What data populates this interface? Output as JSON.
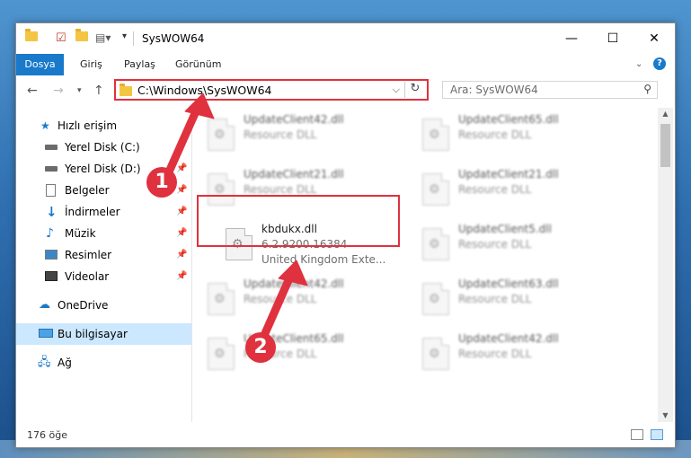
{
  "window": {
    "title": "SysWOW64"
  },
  "ribbon": {
    "tabs": [
      "Dosya",
      "Giriş",
      "Paylaş",
      "Görünüm"
    ]
  },
  "address": {
    "path": "C:\\Windows\\SysWOW64"
  },
  "search": {
    "placeholder": "Ara: SysWOW64"
  },
  "nav": {
    "items": [
      {
        "label": "Hızlı erişim",
        "icon": "star-icon"
      },
      {
        "label": "Yerel Disk (C:)",
        "icon": "drive-icon"
      },
      {
        "label": "Yerel Disk (D:)",
        "icon": "drive-icon"
      },
      {
        "label": "Belgeler",
        "icon": "documents-icon"
      },
      {
        "label": "İndirmeler",
        "icon": "download-icon"
      },
      {
        "label": "Müzik",
        "icon": "music-icon"
      },
      {
        "label": "Resimler",
        "icon": "pictures-icon"
      },
      {
        "label": "Videolar",
        "icon": "videos-icon"
      },
      {
        "label": "OneDrive",
        "icon": "cloud-icon"
      },
      {
        "label": "Bu bilgisayar",
        "icon": "computer-icon"
      },
      {
        "label": "Ağ",
        "icon": "network-icon"
      }
    ]
  },
  "files": [
    {
      "name": "UpdateClient42.dll",
      "desc": "Resource DLL"
    },
    {
      "name": "UpdateClient65.dll",
      "desc": "Resource DLL"
    },
    {
      "name": "UpdateClient21.dll",
      "desc": "Resource DLL"
    },
    {
      "name": "UpdateClient21.dll",
      "desc": "Resource DLL"
    },
    {
      "name": "kbdukx.dll",
      "version": "6.2.9200.16384",
      "desc": "United Kingdom Exte..."
    },
    {
      "name": "UpdateClient5.dll",
      "desc": "Resource DLL"
    },
    {
      "name": "UpdateClient42.dll",
      "desc": "Resource DLL"
    },
    {
      "name": "UpdateClient63.dll",
      "desc": "Resource DLL"
    },
    {
      "name": "UpdateClient65.dll",
      "desc": "Resource DLL"
    },
    {
      "name": "UpdateClient42.dll",
      "desc": "Resource DLL"
    }
  ],
  "status": {
    "count": "176 öğe"
  },
  "callouts": [
    "1",
    "2"
  ],
  "colors": {
    "accent": "#1979ca",
    "highlight": "#e0313e",
    "selected": "#cce8ff"
  }
}
